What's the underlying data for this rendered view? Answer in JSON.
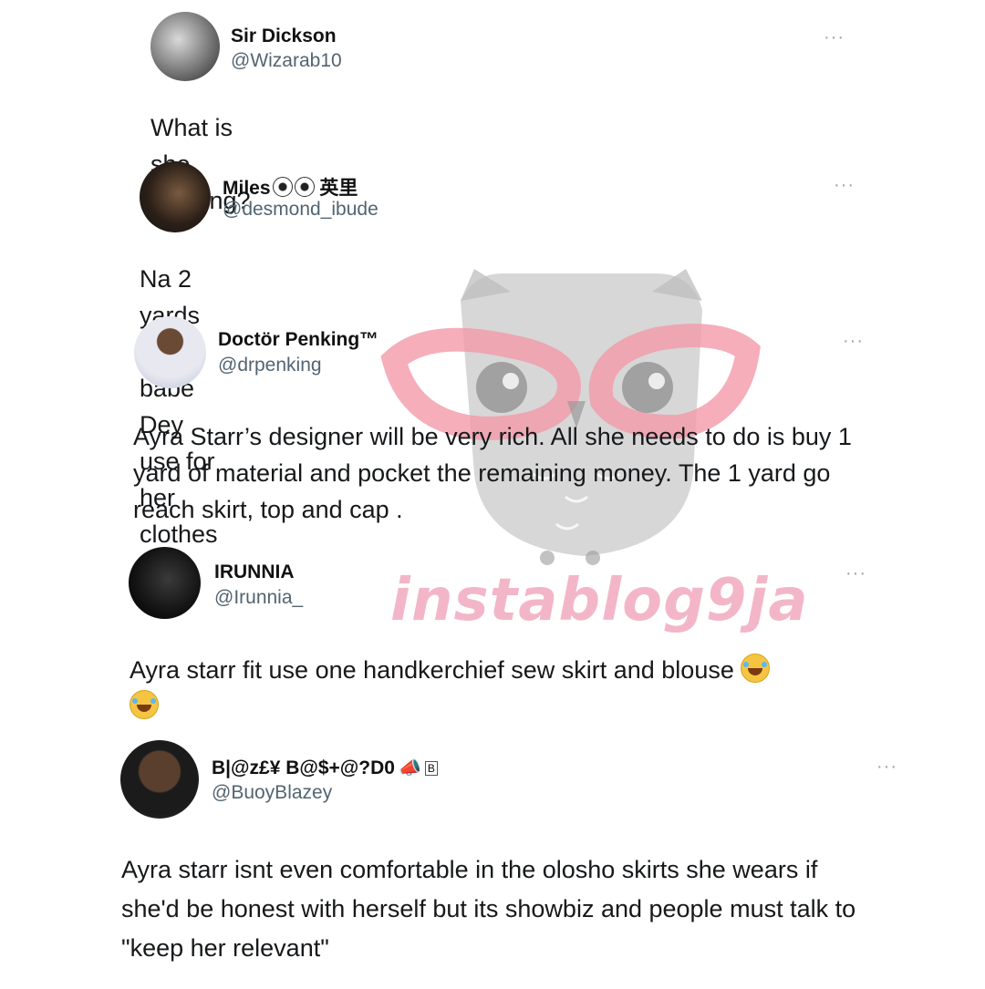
{
  "watermark": {
    "text": "instablog9ja",
    "owl_color": "#c8c8c8",
    "glasses_color": "#f28b9e"
  },
  "tweets": [
    {
      "name": "Sir Dickson",
      "handle": "@Wizarab10",
      "more": "···",
      "text": "What is she wearing?"
    },
    {
      "name": "Miles",
      "name_suffix": "英里",
      "name_icons": [
        "soccer-ball-icon",
        "soccer-ball-icon"
      ],
      "handle": "@desmond_ibude",
      "more": "···",
      "text": "Na 2 yards this babe Dey use for her clothes"
    },
    {
      "name": "Doctör Penking™",
      "handle": "@drpenking",
      "more": "···",
      "text": "Ayra Starr’s designer will be very rich. All she needs to do is buy 1 yard of material and pocket the remaining money. The 1 yard go reach skirt, top and cap ."
    },
    {
      "name": "IRUNNIA",
      "handle": "@Irunnia_",
      "more": "···",
      "text": "Ayra starr fit use one handkerchief sew skirt and blouse",
      "emojis": [
        "rofl-emoji",
        "rofl-emoji"
      ]
    },
    {
      "name": "B|@z£¥ B@$+@?D0",
      "name_badge": "B",
      "name_icons": [
        "megaphone-icon"
      ],
      "handle": "@BuoyBlazey",
      "more": "···",
      "text": "Ayra starr isnt even comfortable in the olosho skirts she wears if she'd be honest with herself but its showbiz and people must talk to \"keep her relevant\""
    }
  ]
}
